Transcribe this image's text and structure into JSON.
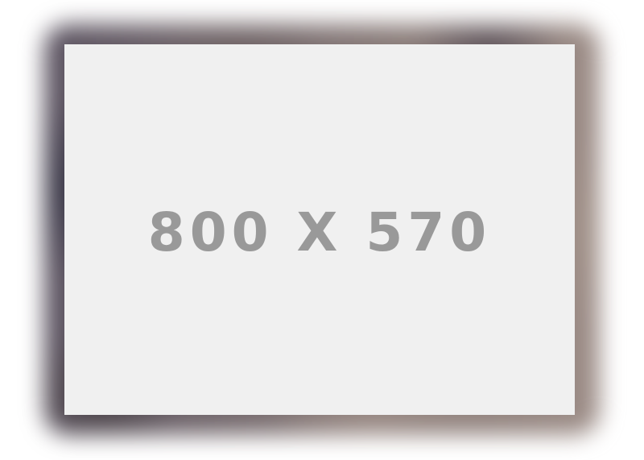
{
  "placeholder": {
    "label": "800 X 570"
  },
  "colors": {
    "panel": "#f0f0f0",
    "label": "#999999"
  }
}
